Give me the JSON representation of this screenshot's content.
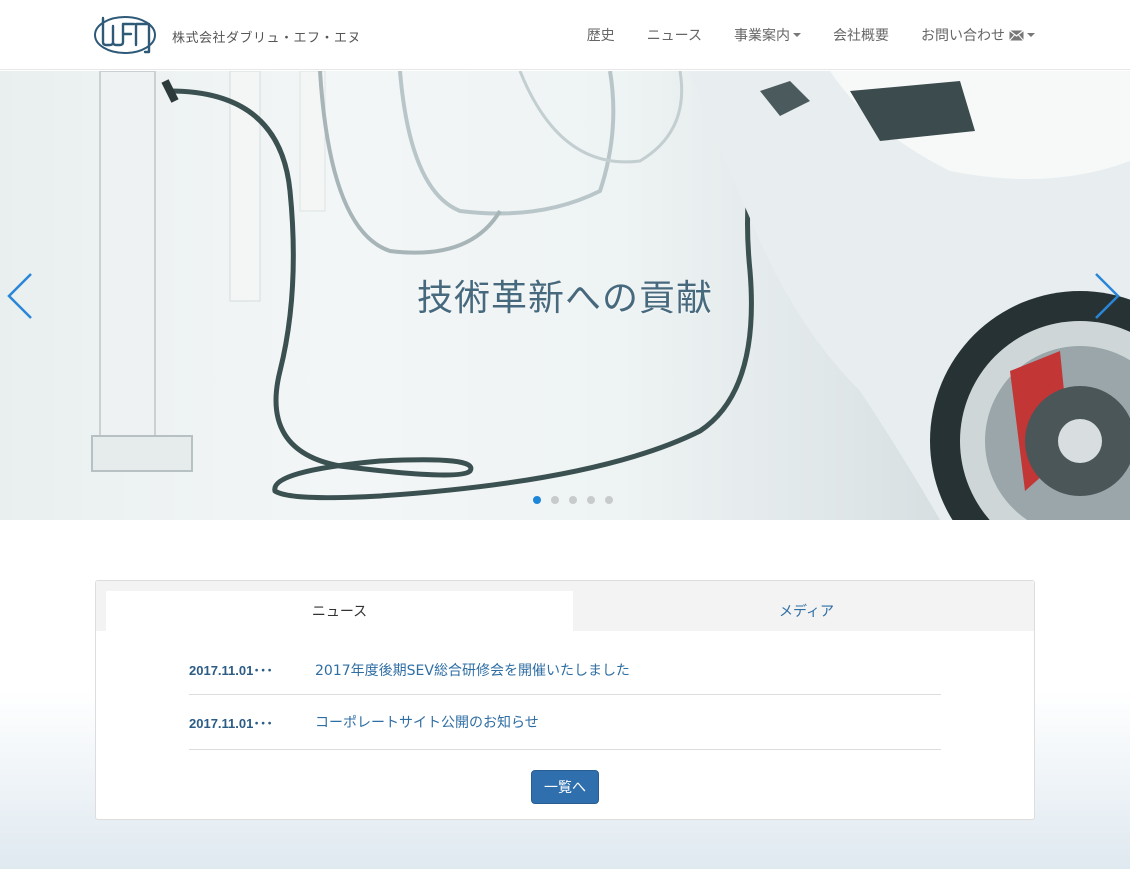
{
  "header": {
    "company_name": "株式会社ダブリュ・エフ・エヌ",
    "logo_icon": "wfn-logo",
    "nav": [
      {
        "label": "歴史",
        "dropdown": false
      },
      {
        "label": "ニュース",
        "dropdown": false
      },
      {
        "label": "事業案内",
        "dropdown": true
      },
      {
        "label": "会社概要",
        "dropdown": false
      },
      {
        "label": "お問い合わせ",
        "dropdown": true,
        "icon": "mail-icon"
      }
    ]
  },
  "carousel": {
    "caption": "技術革新への貢献",
    "slide_count": 5,
    "active_slide": 1,
    "prev_icon": "chevron-left-icon",
    "next_icon": "chevron-right-icon",
    "accent_color": "#1e86d9"
  },
  "news_panel": {
    "tabs": [
      {
        "label": "ニュース",
        "active": true
      },
      {
        "label": "メディア",
        "active": false
      }
    ],
    "items": [
      {
        "date": "2017.11.01･･･",
        "title": "2017年度後期SEV総合研修会を開催いたしました"
      },
      {
        "date": "2017.11.01･･･",
        "title": "コーポレートサイト公開のお知らせ"
      }
    ],
    "more_button": "一覧へ",
    "link_color": "#2f6ea3",
    "button_color": "#2f6fae"
  }
}
